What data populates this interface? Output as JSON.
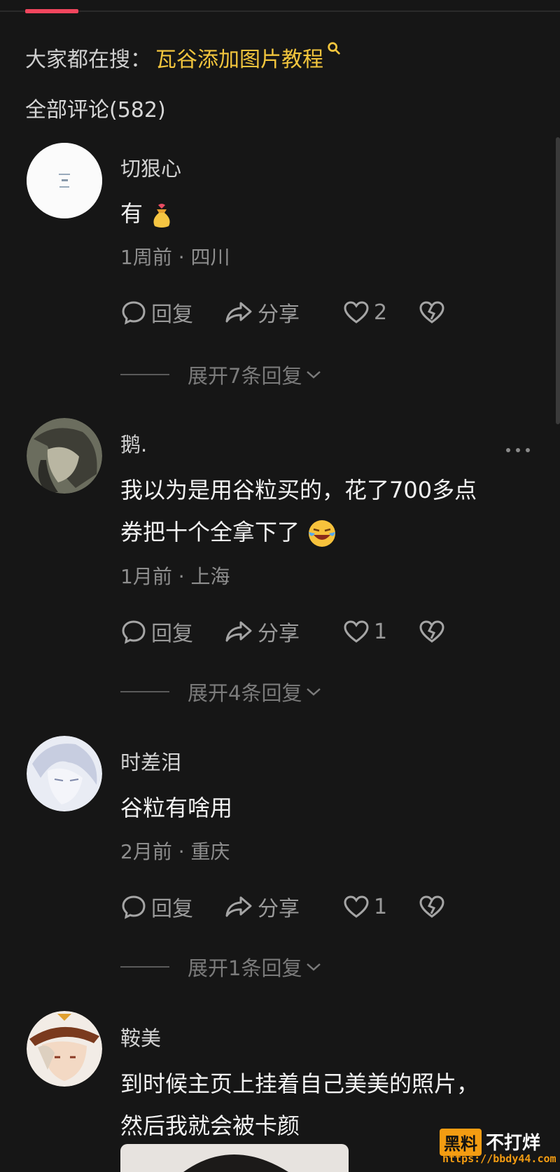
{
  "header": {
    "search_prefix": "大家都在搜：",
    "search_term": "瓦谷添加图片教程",
    "comments_title": "全部评论(582)"
  },
  "comments": [
    {
      "username": "切狠心",
      "text": "有",
      "emoji": "money-bag-emoji",
      "meta": "1周前 · 四川",
      "reply_label": "回复",
      "share_label": "分享",
      "likes": "2",
      "expand_label": "展开7条回复"
    },
    {
      "username": "鹅.",
      "text_line1": "我以为是用谷粒买的，花了700多点",
      "text_line2": "券把十个全拿下了",
      "emoji": "laughing-tears-emoji",
      "meta": "1月前 · 上海",
      "reply_label": "回复",
      "share_label": "分享",
      "likes": "1",
      "expand_label": "展开4条回复"
    },
    {
      "username": "时差泪",
      "text": "谷粒有啥用",
      "meta": "2月前 · 重庆",
      "reply_label": "回复",
      "share_label": "分享",
      "likes": "1",
      "expand_label": "展开1条回复"
    },
    {
      "username": "鞍美",
      "text_line1": "到时候主页上挂着自己美美的照片，",
      "text_line2": "然后我就会被卡颜"
    }
  ],
  "watermark": {
    "badge": "黑料",
    "text": "不打烊",
    "url": "https://bbdy44.com"
  },
  "colors": {
    "background": "#161616",
    "accent": "#f2465e",
    "search_highlight": "#f2c53d",
    "watermark_orange": "#f39c12"
  }
}
